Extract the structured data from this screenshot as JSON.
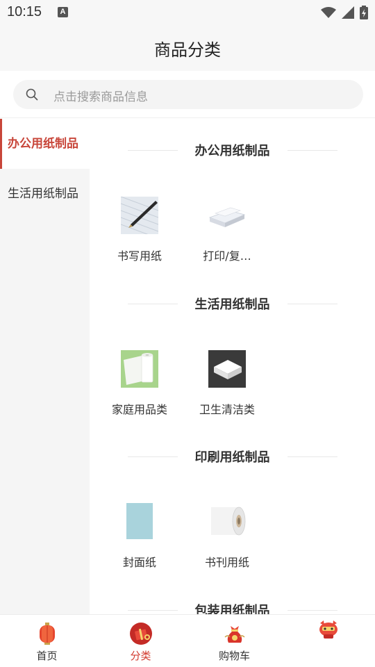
{
  "status_bar": {
    "time": "10:15",
    "a_badge": "A",
    "icons": [
      "wifi-icon",
      "signal-icon",
      "battery-charging-icon"
    ]
  },
  "header": {
    "title": "商品分类"
  },
  "search": {
    "placeholder": "点击搜索商品信息",
    "icon": "search-icon"
  },
  "sidebar": {
    "items": [
      {
        "label": "办公用纸制品",
        "active": true
      },
      {
        "label": "生活用纸制品",
        "active": false
      }
    ]
  },
  "sections": [
    {
      "title": "办公用纸制品",
      "products": [
        {
          "label": "书写用纸",
          "icon": "writing-paper-image"
        },
        {
          "label": "打印/复…",
          "icon": "printing-paper-image"
        }
      ]
    },
    {
      "title": "生活用纸制品",
      "products": [
        {
          "label": "家庭用品类",
          "icon": "household-tissue-image"
        },
        {
          "label": "卫生清洁类",
          "icon": "cleaning-tissue-image"
        }
      ]
    },
    {
      "title": "印刷用纸制品",
      "products": [
        {
          "label": "封面纸",
          "icon": "cover-paper-image"
        },
        {
          "label": "书刊用纸",
          "icon": "book-paper-roll-image"
        }
      ]
    },
    {
      "title": "包装用纸制品",
      "products": []
    }
  ],
  "bottom_nav": {
    "items": [
      {
        "label": "首页",
        "icon": "home-lantern-icon",
        "active": false
      },
      {
        "label": "分类",
        "icon": "category-gift-icon",
        "active": true
      },
      {
        "label": "购物车",
        "icon": "cart-lucky-bag-icon",
        "active": false
      },
      {
        "label": "",
        "icon": "profile-mascot-icon",
        "active": false
      }
    ]
  },
  "colors": {
    "accent": "#c8463a",
    "active_nav": "#d23a2e",
    "sidebar_bg": "#f5f5f5"
  }
}
